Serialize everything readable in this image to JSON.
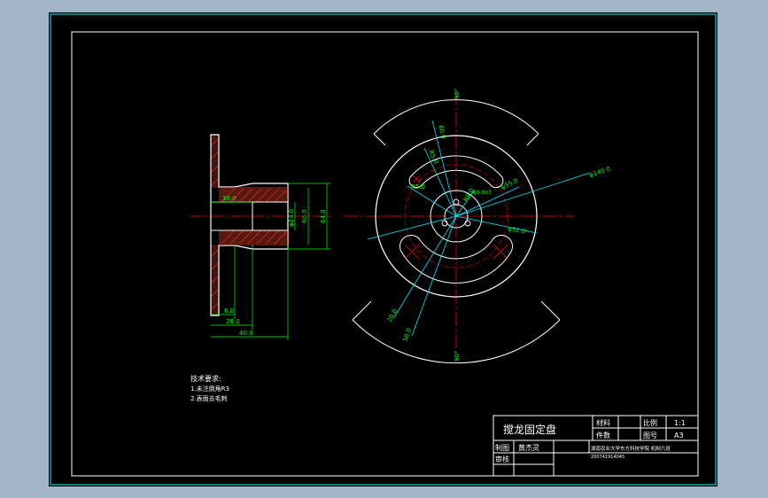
{
  "viewport": {
    "background_color": "#a3b4c6",
    "canvas_color": "#000000"
  },
  "colors": {
    "outline": "#ffffff",
    "frame": "#00ffff",
    "hatch": "#ff2a00",
    "dimension": "#00ff00",
    "leader": "#00e5ff",
    "centerline": "#ff0000",
    "highlight": "#ffff00"
  },
  "section_dims": {
    "bore": "30.0",
    "inner_dia": "φ24.0",
    "outer_dia": "60.0",
    "right_dia": "64.0",
    "thickness": "6.0",
    "hub_len": "28.0",
    "total_len": "40.0"
  },
  "plan_dims": {
    "angle_top": "90°",
    "angle_bottom": "90°",
    "top_r1": "60.0",
    "top_r2": "R5.0",
    "slot_r_small": "R5.0",
    "slot_r_large": "R8.0",
    "bolt_hole": "φ8.0x3",
    "pcd": "φ55.0",
    "outer_dia": "φ140.0",
    "hub_dia": "φ32.0",
    "slot_width_1": "20.0",
    "slot_width_2": "50.0"
  },
  "notes": {
    "heading": "技术要求:",
    "item1": "1.未注倒角R3",
    "item2": "2.表面去毛刺"
  },
  "title_block": {
    "part_name": "搅龙固定盘",
    "material_label": "材料",
    "quantity_label": "件数",
    "scale_label": "比例",
    "scale_value": "1:1",
    "drawing_no_label": "图号",
    "drawing_no_value": "A3",
    "drawn_label": "制图",
    "drawn_name": "黄杰灵",
    "checked_label": "审核",
    "school_line": "湖南农业大学东方科技学院 机制六班",
    "student_no": "200741914045"
  }
}
